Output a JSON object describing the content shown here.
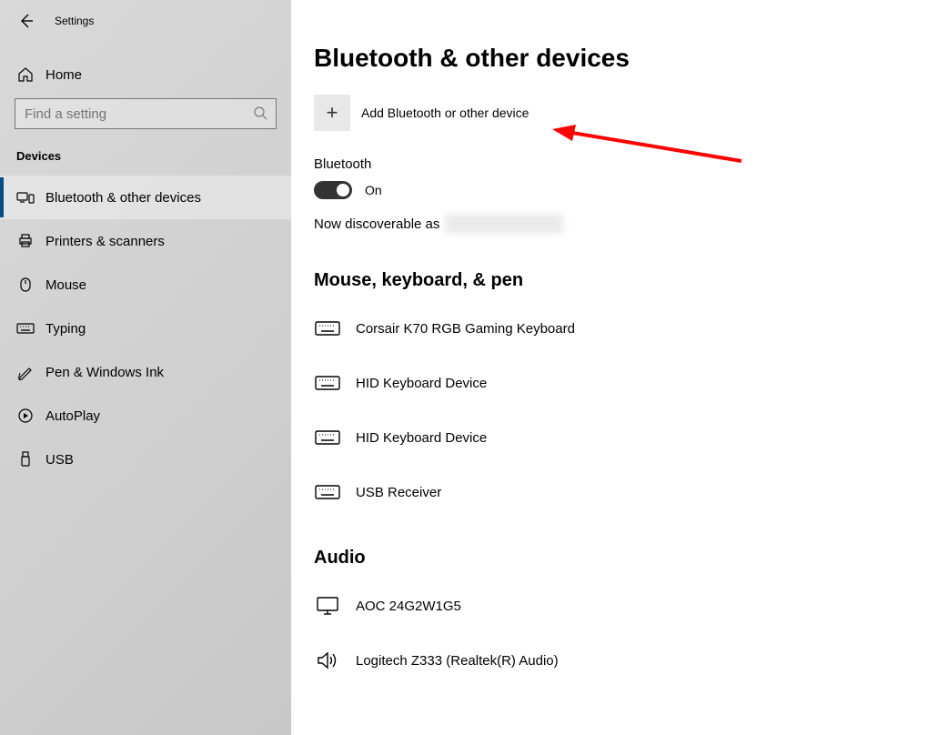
{
  "app": {
    "title": "Settings"
  },
  "sidebar": {
    "home_label": "Home",
    "search_placeholder": "Find a setting",
    "section_label": "Devices",
    "items": [
      {
        "label": "Bluetooth & other devices"
      },
      {
        "label": "Printers & scanners"
      },
      {
        "label": "Mouse"
      },
      {
        "label": "Typing"
      },
      {
        "label": "Pen & Windows Ink"
      },
      {
        "label": "AutoPlay"
      },
      {
        "label": "USB"
      }
    ]
  },
  "main": {
    "title": "Bluetooth & other devices",
    "add_label": "Add Bluetooth or other device",
    "bt_heading": "Bluetooth",
    "bt_state": "On",
    "discover_prefix": "Now discoverable as",
    "group1_title": "Mouse, keyboard, & pen",
    "group1_items": [
      "Corsair K70 RGB Gaming Keyboard",
      "HID Keyboard Device",
      "HID Keyboard Device",
      "USB Receiver"
    ],
    "group2_title": "Audio",
    "group2_items": [
      "AOC 24G2W1G5",
      "Logitech Z333 (Realtek(R) Audio)"
    ]
  }
}
